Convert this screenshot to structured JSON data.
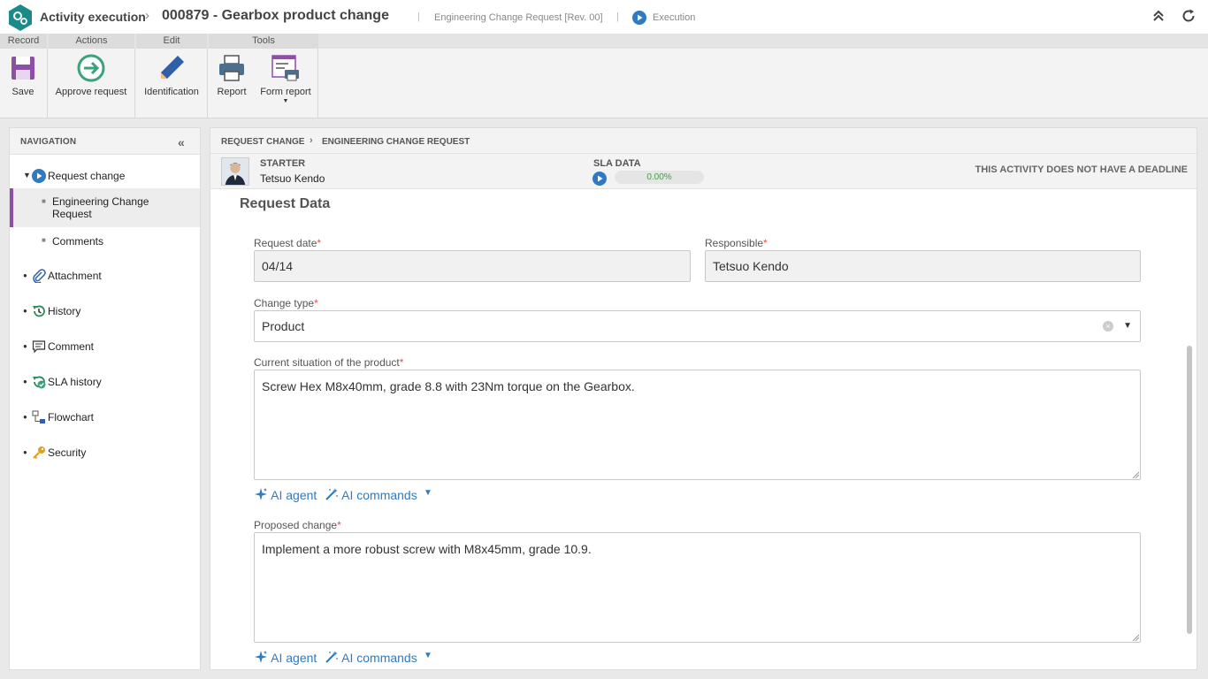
{
  "header": {
    "app_title": "Activity execution",
    "separator": "›",
    "record_title": "000879 - Gearbox product change",
    "pipe": "|",
    "form_name": "Engineering Change Request [Rev. 00]",
    "status": "Execution"
  },
  "ribbon": {
    "groups": {
      "record": "Record",
      "actions": "Actions",
      "edit": "Edit",
      "tools": "Tools"
    },
    "buttons": {
      "save": "Save",
      "approve": "Approve request",
      "identification": "Identification",
      "report": "Report",
      "form_report": "Form report"
    }
  },
  "navigation": {
    "title": "NAVIGATION",
    "items": [
      {
        "label": "Request change",
        "icon": "play-circle-icon"
      },
      {
        "label": "Engineering Change Request"
      },
      {
        "label": "Comments"
      },
      {
        "label": "Attachment",
        "icon": "paperclip-icon"
      },
      {
        "label": "History",
        "icon": "history-icon"
      },
      {
        "label": "Comment",
        "icon": "comment-icon"
      },
      {
        "label": "SLA history",
        "icon": "sla-history-icon"
      },
      {
        "label": "Flowchart",
        "icon": "flowchart-icon"
      },
      {
        "label": "Security",
        "icon": "key-icon"
      }
    ]
  },
  "breadcrumb": {
    "level1": "REQUEST CHANGE",
    "level2": "ENGINEERING CHANGE REQUEST"
  },
  "starter": {
    "label": "STARTER",
    "name": "Tetsuo Kendo",
    "sla_label": "SLA DATA",
    "sla_percent": "0.00%",
    "deadline_text": "THIS ACTIVITY DOES NOT HAVE A DEADLINE"
  },
  "form": {
    "section_title": "Request Data",
    "required_mark": "*",
    "request_date": {
      "label": "Request date",
      "value": "04/14"
    },
    "responsible": {
      "label": "Responsible",
      "value": "Tetsuo Kendo"
    },
    "change_type": {
      "label": "Change type",
      "value": "Product"
    },
    "current_situation": {
      "label": "Current situation of the product",
      "value": "Screw Hex M8x40mm, grade 8.8 with 23Nm torque on the Gearbox."
    },
    "proposed_change": {
      "label": "Proposed change",
      "value": "Implement a more robust screw with M8x45mm, grade 10.9."
    },
    "ai_agent": "AI agent",
    "ai_commands": "AI commands"
  },
  "colors": {
    "accent": "#2f7ac0",
    "active_marker": "#8e4fa6",
    "required": "#d9534f",
    "sla_text": "#4a9a4a"
  }
}
